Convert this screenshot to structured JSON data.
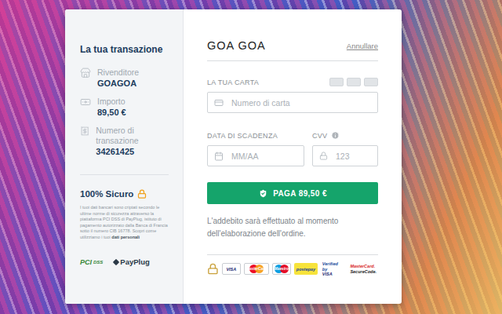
{
  "summary": {
    "title": "La tua transazione",
    "items": [
      {
        "label": "Rivenditore",
        "value": "GOAGOA"
      },
      {
        "label": "Importo",
        "value": "89,50 €"
      },
      {
        "label": "Numero di transazione",
        "value": "34261425"
      }
    ]
  },
  "security": {
    "title": "100% Sicuro",
    "text": "I tuoi dati bancari sono criptati secondo le ultime norme di sicurezza attraverso la piattaforma PCI DSS di PayPlug, istituto di pagamento autorizzato dalla Banca di Francia sotto il numero CIB 16778. Scopri come utilizziamo i tuoi",
    "link": "dati personali"
  },
  "trust_logos": {
    "pci": "PCI",
    "dss": "DSS",
    "payplug": "PayPlug"
  },
  "checkout": {
    "merchant": "GOA GOA",
    "cancel": "Annullare",
    "card": {
      "label": "LA TUA CARTA",
      "placeholder": "Numero di carta"
    },
    "expiry": {
      "label": "DATA DI SCADENZA",
      "placeholder": "MM/AA"
    },
    "cvv": {
      "label": "CVV",
      "placeholder": "123"
    },
    "pay": "PAGA 89,50 €",
    "note": "L'addebito sarà effettuato al momento dell'elaborazione dell'ordine."
  },
  "payment_logos": [
    {
      "kind": "visa",
      "lines": [
        "VISA"
      ]
    },
    {
      "kind": "mastercard",
      "lines": [
        "MasterCard"
      ]
    },
    {
      "kind": "maestro",
      "lines": [
        "Maestro"
      ]
    },
    {
      "kind": "postepay",
      "lines": [
        "postepay"
      ]
    },
    {
      "kind": "verified",
      "lines": [
        "Verified by",
        "VISA"
      ]
    },
    {
      "kind": "securecode",
      "lines": [
        "MasterCard.",
        "SecureCode."
      ]
    }
  ]
}
